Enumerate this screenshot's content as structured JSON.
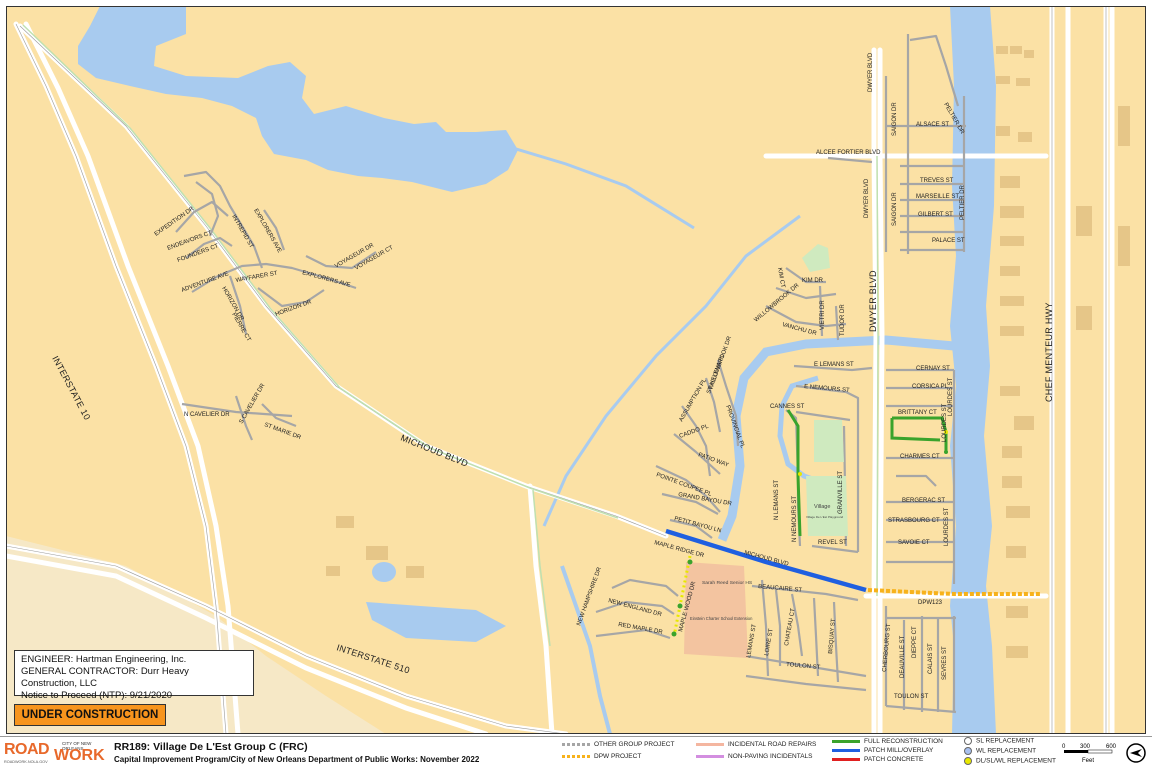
{
  "colors": {
    "land": "#fbe1a5",
    "water": "#a8cbef",
    "road_line": "#ffffff",
    "minor_street": "#a6a6a6",
    "full_reconstruction": "#3aa32c",
    "patch_mill_overlay": "#1f5fe0",
    "patch_concrete": "#e02020",
    "dpw_project": "#f7b21b",
    "incidental_road_repairs": "#f4b6a0",
    "non_paving_incidentals": "#d38ee0",
    "status": "#f7941d",
    "park": "#cfeabf",
    "school": "#f3c4a0"
  },
  "map": {
    "highways": {
      "i10": "INTERSTATE 10",
      "i510": "INTERSTATE 510",
      "michoud": "MICHOUD BLVD",
      "dwyer": "DWYER BLVD",
      "chef": "CHEF MENTEUR HWY"
    },
    "streets": {
      "expedition": "EXPEDITION DR",
      "endeavors": "ENDEAVORS CT",
      "founders": "FOUNDERS CT",
      "adventure": "ADVENTURE AVE",
      "explorers_ave": "EXPLORERS AVE",
      "explorers_ave2": "EXPLORERS AVE",
      "intrepid": "INTREPID ST",
      "wayfarer": "WAYFARER ST",
      "horizon_dr": "HORIZON DR",
      "horizon_dr2": "HORIZON DR",
      "voyageur_dr": "VOYAGEUR DR",
      "voyageur_ct": "VOYAGEUR CT",
      "pierre": "PIERRE CT",
      "n_cavelier": "N CAVELIER DR",
      "s_cavelier": "S CAVELIER DR",
      "st_marie": "ST MARIE DR",
      "alcee": "ALCEE FORTIER BLVD",
      "dwyer_north": "DWYER BLVD",
      "dwyer_north2": "DWYER BLVD",
      "saigon": "SAIGON DR",
      "saigon2": "SAIGON DR",
      "peltier": "PELTIER DR",
      "peltier2": "PELTIER DR",
      "alsace": "ALSACE ST",
      "treves": "TREVES ST",
      "marseille": "MARSEILLE ST",
      "gilbert": "GILBERT ST",
      "palace": "PALACE ST",
      "kim_dr": "KIM DR",
      "kim_ct": "KIM CT",
      "willowbrook": "WILLOWBROOK DR",
      "willowbrook2": "WILLOWBROOK DR",
      "vanchu": "VANCHU DR",
      "vietri": "VIETRI DR",
      "tudor": "TUDOR DR",
      "st_helena": "ST HELENA PL",
      "provincial": "PROVINCIAL PL",
      "assumption": "ASSUMPTION PL",
      "caddo": "CADDO PL",
      "patio": "PATIO WAY",
      "pointe_coupee": "POINTE COUPEE PL",
      "grand_bayou": "GRAND BAYOU DR",
      "petit_bayou": "PETIT BAYOU LN",
      "elemans": "E LEMANS ST",
      "enemours": "E NEMOURS ST",
      "cannes": "CANNES ST",
      "n_lemans": "N LEMANS ST",
      "n_nemours": "N NEMOURS ST",
      "granville": "GRANVILLE ST",
      "revel": "REVEL ST",
      "cernay": "CERNAY ST",
      "corsica": "CORSICA PL",
      "brittany": "BRITTANY CT",
      "lourdes": "LOURDES ST",
      "lourdes2": "LOURDES ST",
      "lourdes3": "LOURDES ST",
      "charmes": "CHARMES CT",
      "bergerac": "BERGERAC ST",
      "strasbourg": "STRASBOURG CT",
      "savoie": "SAVOIE CT",
      "michoud_label": "MICHOUD BLVD",
      "dpw_label": "DPW123",
      "maple_ridge": "MAPLE RIDGE DR",
      "new_hampshire": "NEW HAMPSHIRE DR",
      "new_england": "NEW ENGLAND DR",
      "red_maple": "RED MAPLE DR",
      "maple_wood": "MAPLE WOOD DR",
      "beaucaire": "BEAUCAIRE ST",
      "lemans_s": "LEMANS ST",
      "loire": "LOIRE ST",
      "chateau": "CHATEAU CT",
      "bisquay": "BISQUAY ST",
      "toulon": "TOULON ST",
      "toulon2": "TOULON ST",
      "cherbourg": "CHERBOURG ST",
      "deauville": "DEAUVILLE ST",
      "dieppe": "DIEPPE CT",
      "calais": "CALAIS ST",
      "sevres": "SEVRES ST"
    },
    "pois": {
      "park": "Village De L'Est Playground",
      "sarah_reed": "Sarah Reed Senior HS",
      "einstein": "Einstein Charter School Extension"
    }
  },
  "info": {
    "engineer": "ENGINEER: Hartman Engineering, Inc.",
    "contractor": "GENERAL CONTRACTOR: Durr Heavy Construction, LLC",
    "ntp": "Notice to Proceed (NTP): 9/21/2020"
  },
  "status": "UNDER CONSTRUCTION",
  "footer": {
    "logo_road": "ROAD",
    "logo_work": "WORK",
    "logo_city": "CITY OF NEW ORLEANS",
    "logo_tag": "ROADWORK.NOLA.GOV",
    "title": "RR189:  Village De L'Est Group C (FRC)",
    "subtitle": "Capital Improvement Program/City of New Orleans Department of Public Works:  November 2022"
  },
  "legend": {
    "other_group": "OTHER GROUP PROJECT",
    "dpw": "DPW PROJECT",
    "incidental": "INCIDENTAL ROAD REPAIRS",
    "non_paving": "NON-PAVING INCIDENTALS",
    "full_recon": "FULL RECONSTRUCTION",
    "patch_mill": "PATCH MILL/OVERLAY",
    "patch_concrete": "PATCH CONCRETE",
    "sl": "SL REPLACEMENT",
    "wl": "WL REPLACEMENT",
    "dl": "DL/SL/WL REPLACEMENT"
  },
  "scale": {
    "t0": "0",
    "t1": "300",
    "t2": "600",
    "unit": "Feet"
  }
}
